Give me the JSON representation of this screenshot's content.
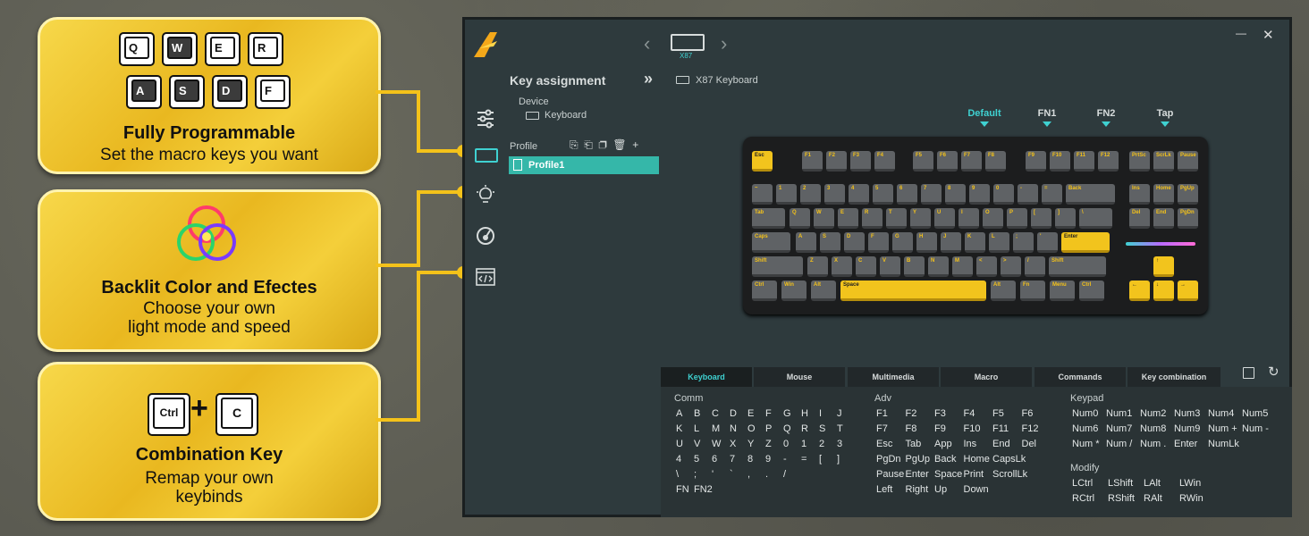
{
  "features": [
    {
      "title": "Fully Programmable",
      "subtitle": [
        "Set the macro keys you want"
      ],
      "keys_top": [
        "Q",
        "W",
        "E",
        "R"
      ],
      "keys_bottom": [
        "A",
        "S",
        "D",
        "F"
      ]
    },
    {
      "title": "Backlit Color and Efectes",
      "subtitle": [
        "Choose your own",
        "light mode and speed"
      ]
    },
    {
      "title": "Combination Key",
      "subtitle": [
        "Remap your own",
        "keybinds"
      ],
      "keys": [
        "Ctrl",
        "C"
      ],
      "plus": "+"
    }
  ],
  "app": {
    "window_controls": {
      "minimize": "—",
      "close": "✕"
    },
    "device_selector": {
      "prev": "‹",
      "next": "›",
      "device_short": "X87"
    },
    "section_title": "Key assignment",
    "collapse": "»",
    "breadcrumb_device": "X87 Keyboard",
    "device_label": "Device",
    "device_name": "Keyboard",
    "profile_label": "Profile",
    "profiles": [
      "Profile1"
    ],
    "layers": [
      "Default",
      "FN1",
      "FN2",
      "Tap"
    ],
    "tabs": [
      "Keyboard",
      "Mouse",
      "Multimedia",
      "Macro",
      "Commands",
      "Key combination"
    ],
    "comm": {
      "title": "Comm",
      "rows": [
        [
          "A",
          "B",
          "C",
          "D",
          "E",
          "F",
          "G",
          "H",
          "I",
          "J"
        ],
        [
          "K",
          "L",
          "M",
          "N",
          "O",
          "P",
          "Q",
          "R",
          "S",
          "T"
        ],
        [
          "U",
          "V",
          "W",
          "X",
          "Y",
          "Z",
          "0",
          "1",
          "2",
          "3"
        ],
        [
          "4",
          "5",
          "6",
          "7",
          "8",
          "9",
          "-",
          "=",
          "[",
          "]"
        ],
        [
          "\\",
          ";",
          "'",
          "`",
          ",",
          ".",
          "/"
        ],
        [
          "FN",
          "FN2"
        ]
      ]
    },
    "adv": {
      "title": "Adv",
      "rows": [
        [
          "F1",
          "F2",
          "F3",
          "F4",
          "F5",
          "F6"
        ],
        [
          "F7",
          "F8",
          "F9",
          "F10",
          "F11",
          "F12"
        ],
        [
          "Esc",
          "Tab",
          "App",
          "Ins",
          "End",
          "Del"
        ],
        [
          "PgDn",
          "PgUp",
          "Back",
          "Home",
          "CapsLk"
        ],
        [
          "Pause",
          "Enter",
          "Space",
          "Print",
          "ScrollLk"
        ],
        [
          "Left",
          "Right",
          "Up",
          "Down"
        ]
      ]
    },
    "keypad": {
      "title": "Keypad",
      "rows": [
        [
          "Num0",
          "Num1",
          "Num2",
          "Num3",
          "Num4",
          "Num5"
        ],
        [
          "Num6",
          "Num7",
          "Num8",
          "Num9",
          "Num +",
          "Num -"
        ],
        [
          "Num *",
          "Num /",
          "Num .",
          "Enter",
          "NumLk"
        ]
      ]
    },
    "modify": {
      "title": "Modify",
      "rows": [
        [
          "LCtrl",
          "LShift",
          "LAlt",
          "LWin"
        ],
        [
          "RCtrl",
          "RShift",
          "RAlt",
          "RWin"
        ]
      ]
    },
    "keyboard_rows": [
      [
        "Esc",
        "F1",
        "F2",
        "F3",
        "F4",
        "F5",
        "F6",
        "F7",
        "F8",
        "F9",
        "F10",
        "F11",
        "F12",
        "PrtSc",
        "ScrLk",
        "Pause"
      ],
      [
        "~",
        "1",
        "2",
        "3",
        "4",
        "5",
        "6",
        "7",
        "8",
        "9",
        "0",
        "-",
        "=",
        "Back",
        "Ins",
        "Home",
        "PgUp"
      ],
      [
        "Tab",
        "Q",
        "W",
        "E",
        "R",
        "T",
        "Y",
        "U",
        "I",
        "O",
        "P",
        "[",
        "]",
        "\\",
        "Del",
        "End",
        "PgDn"
      ],
      [
        "Caps",
        "A",
        "S",
        "D",
        "F",
        "G",
        "H",
        "J",
        "K",
        "L",
        ";",
        "'",
        "Enter"
      ],
      [
        "Shift",
        "Z",
        "X",
        "C",
        "V",
        "B",
        "N",
        "M",
        "<",
        ">",
        "/",
        "Shift",
        "↑"
      ],
      [
        "Ctrl",
        "Win",
        "Alt",
        "Space",
        "Alt",
        "Fn",
        "Menu",
        "Ctrl",
        "←",
        "↓",
        "→"
      ]
    ],
    "accent_color": "#3fd1d1"
  }
}
